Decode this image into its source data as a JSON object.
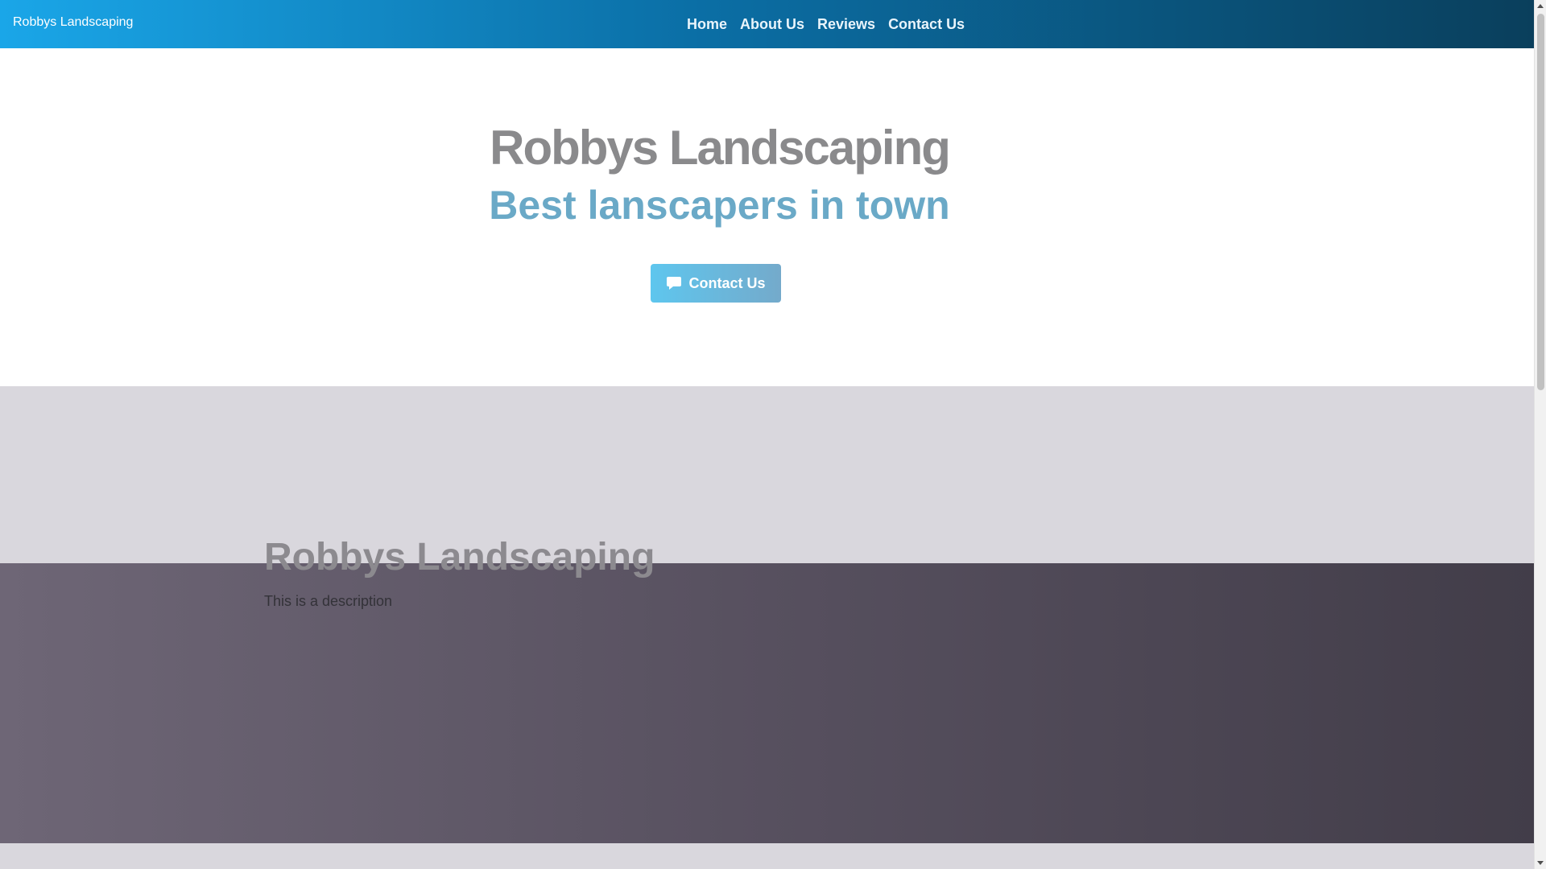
{
  "navbar": {
    "brand": "Robbys Landscaping",
    "links": [
      {
        "label": "Home"
      },
      {
        "label": "About Us"
      },
      {
        "label": "Reviews"
      },
      {
        "label": "Contact Us"
      }
    ]
  },
  "hero": {
    "title": "Robbys Landscaping",
    "subtitle": "Best lanscapers in town",
    "button_label": "Contact Us",
    "button_icon": "chat-icon"
  },
  "about": {
    "title": "Robbys Landscaping",
    "description": "This is a description"
  },
  "colors": {
    "nav_start": "#1aa6e8",
    "nav_end": "#0a3f5c",
    "subtitle": "#6aa9c7",
    "button": "#5ec6ee"
  }
}
